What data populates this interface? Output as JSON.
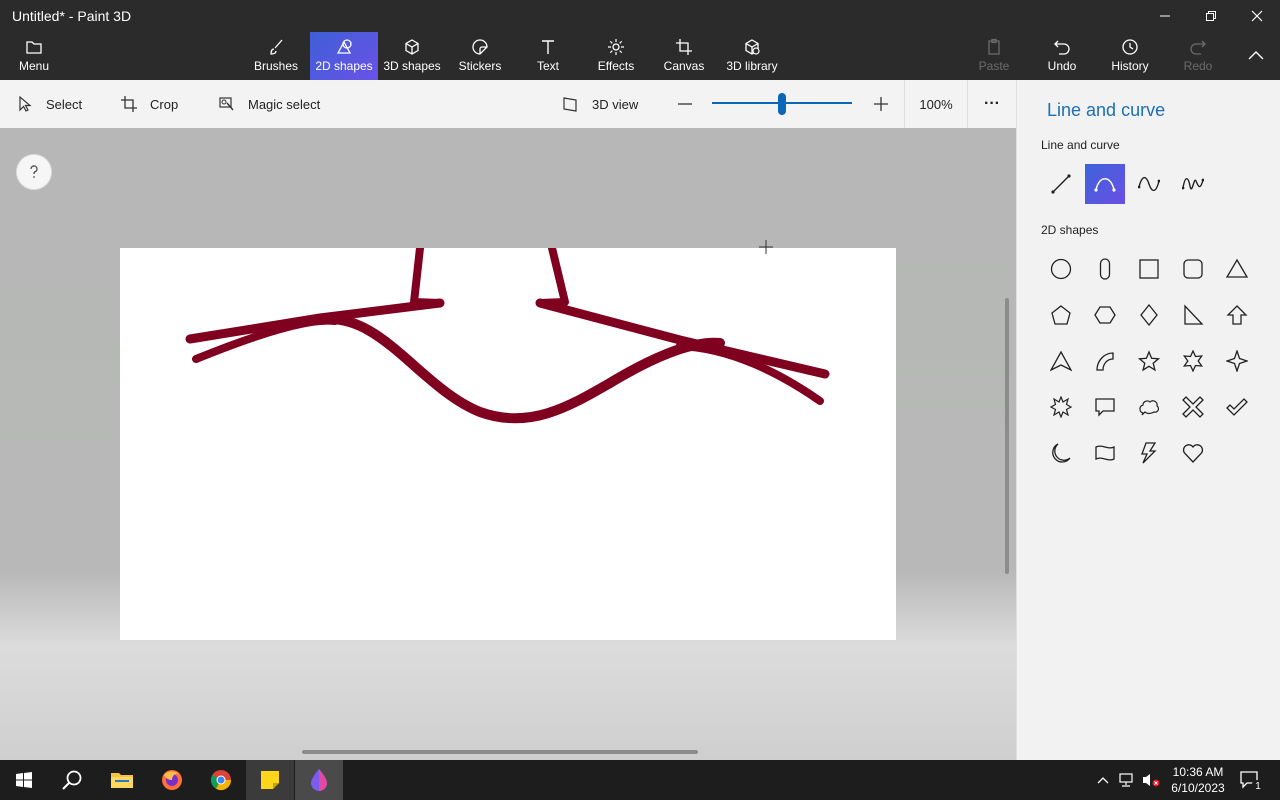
{
  "window": {
    "title": "Untitled* - Paint 3D"
  },
  "ribbon": {
    "menu_label": "Menu",
    "tabs": [
      {
        "label": "Brushes"
      },
      {
        "label": "2D shapes"
      },
      {
        "label": "3D shapes"
      },
      {
        "label": "Stickers"
      },
      {
        "label": "Text"
      },
      {
        "label": "Effects"
      },
      {
        "label": "Canvas"
      },
      {
        "label": "3D library"
      }
    ],
    "actions": [
      {
        "label": "Paste"
      },
      {
        "label": "Undo"
      },
      {
        "label": "History"
      },
      {
        "label": "Redo"
      }
    ]
  },
  "toolbar": {
    "select": "Select",
    "crop": "Crop",
    "magic_select": "Magic select",
    "view_3d": "3D view",
    "zoom_value": "100%",
    "zoom_fraction": 0.5,
    "more": "···"
  },
  "panel": {
    "title": "Line and curve",
    "line_section": "Line and curve",
    "shapes_section": "2D shapes"
  },
  "canvas": {
    "stroke_color": "#800020"
  },
  "colors": {
    "accent": "#0a66b8",
    "ribbon_bg": "#2b2b2b",
    "panel_title": "#1b6fb5"
  },
  "taskbar": {
    "time": "10:36 AM",
    "date": "6/10/2023",
    "notification_count": "1"
  }
}
